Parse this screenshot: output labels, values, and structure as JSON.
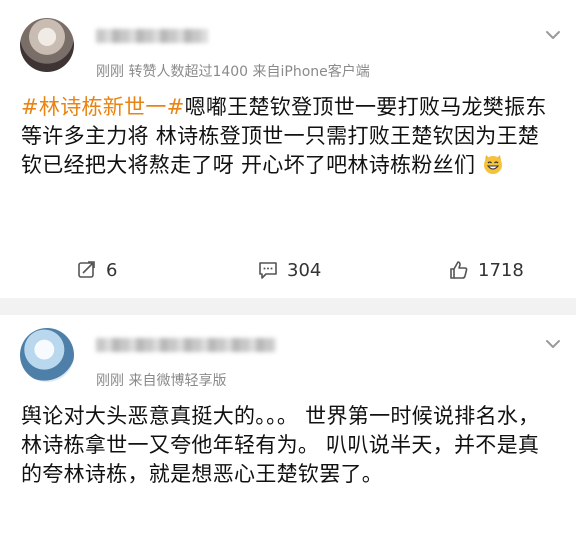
{
  "posts": [
    {
      "meta": "刚刚 转赞人数超过1400 来自iPhone客户端",
      "hashtag": "#林诗栋新世一#",
      "text": "嗯嘟王楚钦登顶世一要打败马龙樊振东等许多主力将 林诗栋登顶世一只需打败王楚钦因为王楚钦已经把大将熬走了呀 开心坏了吧林诗栋粉丝们",
      "emoji": "cat-grin-icon",
      "actions": {
        "repost_count": "6",
        "comment_count": "304",
        "like_count": "1718"
      }
    },
    {
      "meta": "刚刚 来自微博轻享版",
      "text": "舆论对大头恶意真挺大的。。。 世界第一时候说排名水，林诗栋拿世一又夸他年轻有为。 叭叭说半天，并不是真的夸林诗栋，就是想恶心王楚钦罢了。"
    }
  ],
  "colors": {
    "hashtag": "#e98312",
    "meta": "#8a8a8a",
    "separator": "#f2f2f2"
  }
}
